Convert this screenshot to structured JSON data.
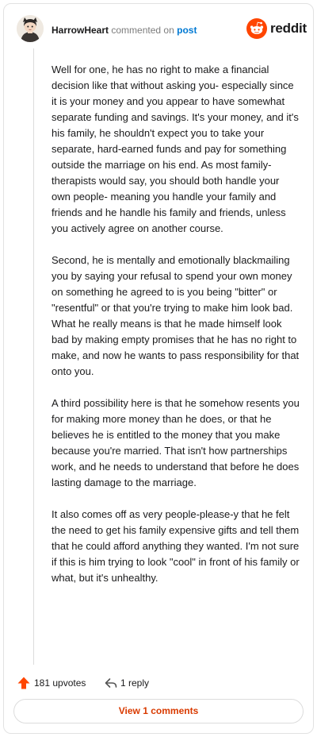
{
  "comment": {
    "author": "HarrowHeart",
    "action_text": "commented on",
    "target_link": "post",
    "paragraphs": [
      "Well for one, he has no right to make a financial decision like that without asking you- especially since it is your money and you appear to have somewhat separate funding and savings. It's your money, and it's his family, he shouldn't expect you to take your separate, hard-earned funds and pay for something outside the marriage on his end. As most family-therapists would say, you should both handle your own people- meaning you handle your family and friends and he handle his family and friends, unless you actively agree on another course.",
      "Second, he is mentally and emotionally blackmailing you by saying your refusal to spend your own money on something he agreed to is you being \"bitter\" or \"resentful\" or that you're trying to make him look bad. What he really means is that he made himself look bad by making empty promises that he has no right to make, and now he wants to pass responsibility for that onto you.",
      "A third possibility here is that he somehow resents you for making more money than he does, or that he believes he is entitled to the money that you make because you're married. That isn't how partnerships work, and he needs to understand that before he does lasting damage to the marriage.",
      "It also comes off as very people-please-y that he felt the need to get his family expensive gifts and tell them that he could afford anything they wanted. I'm not sure if this is him trying to look \"cool\" in front of his family or what, but it's unhealthy."
    ],
    "upvotes_label": "181 upvotes",
    "reply_label": "1 reply",
    "view_comments_label": "View 1 comments"
  },
  "brand": {
    "wordmark": "reddit",
    "icon": "reddit-snoo-icon"
  },
  "icons": {
    "upvote": "upvote-arrow-icon",
    "reply": "reply-arrow-icon",
    "avatar": "user-avatar"
  },
  "colors": {
    "brand_orange": "#ff4500",
    "link_blue": "#0079d3",
    "button_text": "#d93a00",
    "text": "#1a1a1b",
    "muted": "#7c7c7c"
  }
}
